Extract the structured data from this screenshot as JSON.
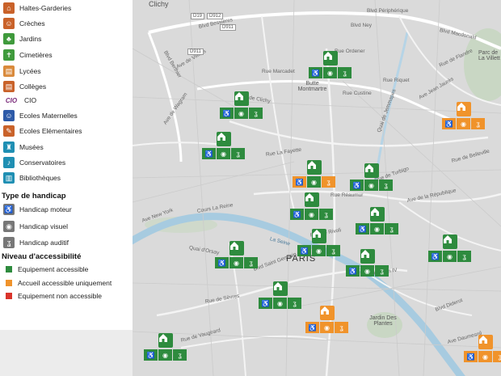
{
  "legend": {
    "equipments": [
      {
        "label": "Haltes-Garderies",
        "icon": "stroller-icon",
        "color": "#c9622a"
      },
      {
        "label": "Crèches",
        "icon": "baby-icon",
        "color": "#c9622a"
      },
      {
        "label": "Jardins",
        "icon": "tree-icon",
        "color": "#3f9a3c"
      },
      {
        "label": "Cimetières",
        "icon": "cross-icon",
        "color": "#3f9a3c"
      },
      {
        "label": "Lycées",
        "icon": "book-icon",
        "color": "#d98a3c"
      },
      {
        "label": "Collèges",
        "icon": "book-icon",
        "color": "#c9622a"
      },
      {
        "label": "CIO",
        "icon": "cio-logo-icon",
        "color": "#7a2a7a"
      },
      {
        "label": "Ecoles Maternelles",
        "icon": "child-icon",
        "color": "#2d5aa8"
      },
      {
        "label": "Ecoles Elémentaires",
        "icon": "school-icon",
        "color": "#c9622a"
      },
      {
        "label": "Musées",
        "icon": "museum-icon",
        "color": "#1f8fb3"
      },
      {
        "label": "Conservatoires",
        "icon": "music-icon",
        "color": "#1f8fb3"
      },
      {
        "label": "Bibliothèques",
        "icon": "library-icon",
        "color": "#1f8fb3"
      }
    ],
    "handicap_title": "Type de handicap",
    "handicaps": [
      {
        "label": "Handicap moteur",
        "icon": "wheelchair-icon"
      },
      {
        "label": "Handicap visuel",
        "icon": "eye-icon"
      },
      {
        "label": "Handicap auditif",
        "icon": "ear-icon"
      }
    ],
    "access_title": "Niveau d'accessibilité",
    "access_levels": [
      {
        "label": "Equipement accessible",
        "color": "#2e8b3e"
      },
      {
        "label": "Accueil accessible uniquement",
        "color": "#f0932b"
      },
      {
        "label": "Equipement non accessible",
        "color": "#d9342b"
      }
    ]
  },
  "map": {
    "place_labels": [
      "Clichy",
      "Butte Montmartre",
      "PARIS",
      "Jardin Des Plantes",
      "Parc de La Villett"
    ],
    "street_labels": [
      "Blvd Bessières",
      "Blvd Ney",
      "Blvd Périphérique",
      "Blvd Macdonald",
      "Rue Ordener",
      "Rue Marcadet",
      "Rue Custine",
      "Rue Riquet",
      "Rue de Flandre",
      "Ave Jean Jaurès",
      "Rue de Belleville",
      "Rue La Fayette",
      "Rue Réaumur",
      "Ave de la République",
      "Rue de Turbigo",
      "Quai de Jemmapes",
      "Blvd Henri IV",
      "Rue de Rivoli",
      "Quai d'Orsay",
      "Blvd Saint Germain",
      "Rue de Sèvres",
      "Rue de Vaugirard",
      "Blvd Diderot",
      "Cours La Reine",
      "Ave New York",
      "Ave de Wagram",
      "Ave de Villiers",
      "Blvd Berthier",
      "Blvd de Clichy",
      "Ave Daumesnil",
      "La Seine"
    ],
    "road_numbers": [
      "D19",
      "D911",
      "D912",
      "D911"
    ],
    "accessible_color": "#2e8b3e",
    "reception_only_color": "#f0932b",
    "markers": [
      {
        "type": "library-icon",
        "house_color": "#2e8b3e",
        "badges": [
          "#2e8b3e",
          "#2e8b3e",
          "#2e8b3e"
        ]
      },
      {
        "type": "library-icon",
        "house_color": "#2e8b3e",
        "badges": [
          "#2e8b3e",
          "#2e8b3e",
          "#2e8b3e"
        ]
      },
      {
        "type": "library-icon",
        "house_color": "#2e8b3e",
        "badges": [
          "#2e8b3e",
          "#2e8b3e",
          "#2e8b3e"
        ]
      },
      {
        "type": "library-icon",
        "house_color": "#f0932b",
        "badges": [
          "#f0932b",
          "#f0932b",
          "#f0932b"
        ]
      },
      {
        "type": "library-icon",
        "house_color": "#2e8b3e",
        "badges": [
          "#2e8b3e",
          "#2e8b3e",
          "#2e8b3e"
        ]
      },
      {
        "type": "library-icon",
        "house_color": "#2e8b3e",
        "badges": [
          "#2e8b3e",
          "#2e8b3e",
          "#2e8b3e"
        ]
      },
      {
        "type": "library-icon",
        "house_color": "#2e8b3e",
        "badges": [
          "#2e8b3e",
          "#2e8b3e",
          "#2e8b3e"
        ]
      },
      {
        "type": "library-icon",
        "house_color": "#2e8b3e",
        "badges": [
          "#2e8b3e",
          "#2e8b3e",
          "#2e8b3e"
        ]
      },
      {
        "type": "library-icon",
        "house_color": "#2e8b3e",
        "badges": [
          "#2e8b3e",
          "#2e8b3e",
          "#2e8b3e"
        ]
      },
      {
        "type": "library-icon",
        "house_color": "#2e8b3e",
        "badges": [
          "#2e8b3e",
          "#2e8b3e",
          "#2e8b3e"
        ]
      },
      {
        "type": "library-icon",
        "house_color": "#2e8b3e",
        "badges": [
          "#2e8b3e",
          "#2e8b3e",
          "#2e8b3e"
        ]
      },
      {
        "type": "library-icon",
        "house_color": "#2e8b3e",
        "badges": [
          "#2e8b3e",
          "#2e8b3e",
          "#2e8b3e"
        ]
      },
      {
        "type": "library-icon",
        "house_color": "#2e8b3e",
        "badges": [
          "#2e8b3e",
          "#2e8b3e",
          "#2e8b3e"
        ]
      },
      {
        "type": "library-icon",
        "house_color": "#f0932b",
        "badges": [
          "#f0932b",
          "#f0932b",
          "#f0932b"
        ]
      },
      {
        "type": "library-icon",
        "house_color": "#2e8b3e",
        "badges": [
          "#2e8b3e",
          "#2e8b3e",
          "#2e8b3e"
        ]
      },
      {
        "type": "library-icon",
        "house_color": "#f0932b",
        "badges": [
          "#f0932b",
          "#f0932b",
          "#f0932b"
        ]
      },
      {
        "type": "library-icon",
        "house_color": "#2e8b3e",
        "badges": [
          "#2e8b3e",
          "#2e8b3e",
          "#2e8b3e"
        ]
      }
    ]
  }
}
